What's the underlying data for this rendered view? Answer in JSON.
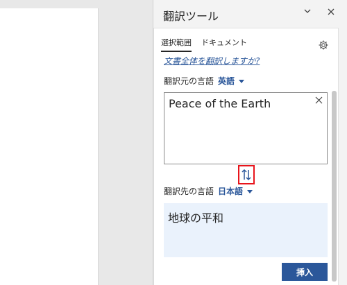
{
  "pane": {
    "title": "翻訳ツール",
    "options_icon": "chevron-down-icon",
    "close_icon": "close-icon"
  },
  "tabs": [
    {
      "label": "選択範囲",
      "active": true
    },
    {
      "label": "ドキュメント",
      "active": false
    }
  ],
  "settings_icon": "gear-icon",
  "translate_all_link": "文書全体を翻訳しますか?",
  "source": {
    "label": "翻訳元の言語",
    "language": "英語",
    "text": "Peace of the Earth"
  },
  "swap_icon": "swap-arrows-icon",
  "target": {
    "label": "翻訳先の言語",
    "language": "日本語",
    "text": "地球の平和"
  },
  "insert_button": "挿入",
  "colors": {
    "accent": "#2b579a",
    "highlight": "#e8141b",
    "result_bg": "#eaf2fc"
  }
}
